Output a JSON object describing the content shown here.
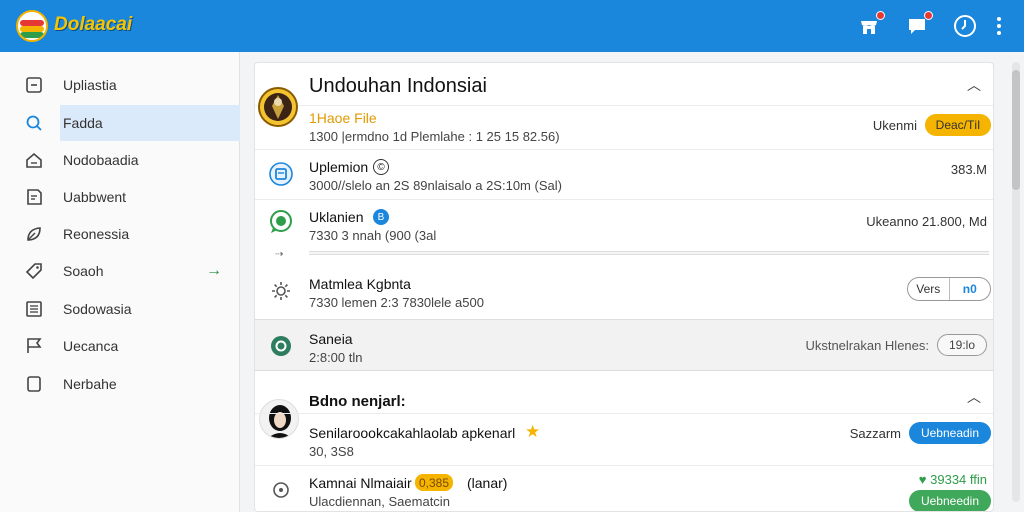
{
  "app": {
    "brand": "Dolaacai"
  },
  "topbar": {
    "icons": [
      "store-icon",
      "chat-icon",
      "power-icon",
      "more-vert-icon"
    ]
  },
  "sidebar": {
    "items": [
      {
        "label": "Upliastia",
        "icon": "window-icon"
      },
      {
        "label": "Fadda",
        "icon": "search-icon",
        "active": true
      },
      {
        "label": "Nodobaadia",
        "icon": "home-icon"
      },
      {
        "label": "Uabbwent",
        "icon": "document-icon"
      },
      {
        "label": "Reonessia",
        "icon": "leaf-icon"
      },
      {
        "label": "Soaoh",
        "icon": "tag-icon"
      },
      {
        "label": "Sodowasia",
        "icon": "list-icon"
      },
      {
        "label": "Uecanca",
        "icon": "flag-icon"
      },
      {
        "label": "Nerbahe",
        "icon": "square-icon"
      }
    ],
    "expand_arrow": "→"
  },
  "section1": {
    "title": "Undouhan Indonsiai",
    "collapse": "︿",
    "rows": [
      {
        "title": "1Haoe File",
        "sub": "1300 |ermdno 1d Plemlahe : 1 25 15 82.56)",
        "right_label": "Ukenmi",
        "pill": "Deaс/ТiI"
      },
      {
        "title": "Uplemion",
        "title_badge": "©",
        "sub": "3000//slelo an 2S 89nlaisalo a 2S:10m (Sal)",
        "right": "383.M"
      },
      {
        "title": "Uklanien",
        "title_badge": "B",
        "sub": "7330 3 nnah (900 (3al",
        "right": "Ukeanno 21.800, Md"
      },
      {
        "title": "Matmlea Kgbnta",
        "sub": "7330 lemen 2:3 7830lele a500",
        "toggle": [
          "Vers",
          "n0"
        ]
      },
      {
        "title": "Saneia",
        "sub": "2:8:00 tln",
        "right_label": "Ukstnelrakan Hlenes:",
        "pill": "19:lo"
      }
    ]
  },
  "section2": {
    "title": "Bdno nenjarl:",
    "collapse": "︿",
    "rows": [
      {
        "title": "Senilaroookcakahlaolab apkenarl",
        "sub": "30, 3S8",
        "right_label": "Sazzarm",
        "pill": "Uebneadin"
      },
      {
        "title": "Kamnai Nlmaiair",
        "title_badge": "0,385",
        "title_suffix": "(lanar)",
        "sub": "Ulacdiennan, Saematcin",
        "right": "♥ 39334 ffin",
        "pill": "Uebneedin"
      }
    ]
  },
  "colors": {
    "topbar": "#1a86dc",
    "accent_yellow": "#f4b400",
    "accent_blue": "#1a86dc",
    "accent_green": "#2e9e4a"
  }
}
